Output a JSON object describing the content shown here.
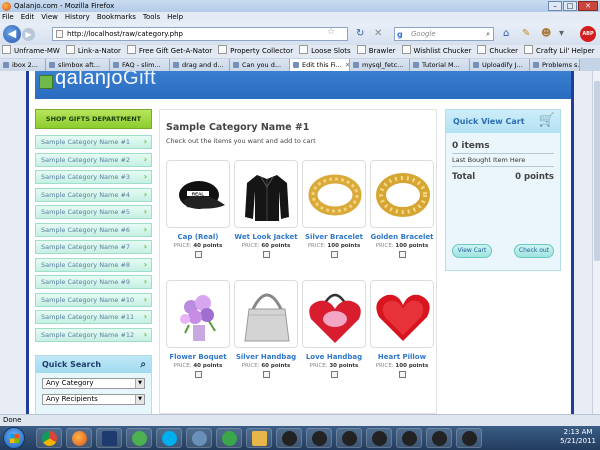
{
  "window": {
    "title": "Qalanjo.com - Mozilla Firefox"
  },
  "menu": [
    "File",
    "Edit",
    "View",
    "History",
    "Bookmarks",
    "Tools",
    "Help"
  ],
  "nav": {
    "url": "http://localhost/raw/category.php",
    "search_placeholder": "Google"
  },
  "bookmarks": [
    "Unframe-MW",
    "Link-a-Nator",
    "Free Gift Get-A-Nator",
    "Property Collector",
    "Loose Slots",
    "Brawler",
    "Wishlist Chucker",
    "Chucker",
    "Crafty Lil' Helper"
  ],
  "tabs": [
    {
      "label": "ibox 2..."
    },
    {
      "label": "slimbox aft..."
    },
    {
      "label": "FAQ - slim..."
    },
    {
      "label": "drag and d..."
    },
    {
      "label": "Can you d..."
    },
    {
      "label": "Edit this Fi..."
    },
    {
      "label": "mysql_fetc..."
    },
    {
      "label": "Tutorial M..."
    },
    {
      "label": "Uploadify J..."
    },
    {
      "label": "Problems s..."
    }
  ],
  "site": {
    "logo": "qalanjo",
    "logo_suffix": "Gift",
    "shop_button": "SHOP GIFTS DEPARTMENT",
    "categories": [
      "Sample Category Name #1",
      "Sample Category Name #2",
      "Sample Category Name #3",
      "Sample Category Name #4",
      "Sample Category Name #5",
      "Sample Category Name #6",
      "Sample Category Name #7",
      "Sample Category Name #8",
      "Sample Category Name #9",
      "Sample Category Name #10",
      "Sample Category Name #11",
      "Sample Category Name #12"
    ],
    "quick_search": {
      "title": "Quick Search",
      "select1": "Any Category",
      "select2": "Any Recipients"
    },
    "main": {
      "title": "Sample Category Name #1",
      "subtitle": "Check out the items you want and add to cart"
    },
    "price_label": "PRICE:",
    "products": [
      {
        "name": "Cap (Real)",
        "price": "40 points"
      },
      {
        "name": "Wet Look Jacket",
        "price": "60 points"
      },
      {
        "name": "Silver Bracelet",
        "price": "100 points"
      },
      {
        "name": "Golden Bracelet",
        "price": "100 points"
      },
      {
        "name": "Flower Boquet",
        "price": "40 points"
      },
      {
        "name": "Silver Handbag",
        "price": "60 points"
      },
      {
        "name": "Love Handbag",
        "price": "30 points"
      },
      {
        "name": "Heart Pillow",
        "price": "100 points"
      }
    ],
    "cart": {
      "title": "Quick View Cart",
      "items": "0 items",
      "last_bought": "Last Bought Item Here",
      "total_label": "Total",
      "total_value": "0 points",
      "view_cart": "View Cart",
      "check_out": "Check out"
    }
  },
  "status": "Done",
  "clock": {
    "time": "2:13 AM",
    "date": "5/21/2011"
  }
}
